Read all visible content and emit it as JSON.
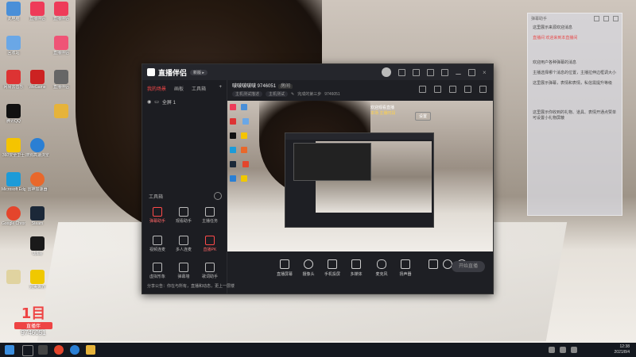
{
  "desktop_icons": [
    {
      "label": "此电脑",
      "color": "#4a8fd8"
    },
    {
      "label": "回收站",
      "color": "#6aa7e6"
    },
    {
      "label": "网易云音乐",
      "color": "#d33"
    },
    {
      "label": "腾讯QQ",
      "color": "#111"
    },
    {
      "label": "360安全卫士",
      "color": "#f5c400"
    },
    {
      "label": "Microsoft Edge",
      "color": "#1c9bd8"
    },
    {
      "label": "Google Chrome",
      "color": "#e4452c"
    },
    {
      "label": "",
      "color": "#e0d3a0"
    },
    {
      "label": "直播伴侣",
      "color": "#ee3b59"
    },
    {
      "label": "WeGame",
      "color": "#c22"
    },
    {
      "label": "搜狗高速浏览器",
      "color": "#2a7fd4"
    },
    {
      "label": "雷神加速器",
      "color": "#e8682b"
    },
    {
      "label": "Steam",
      "color": "#1b2838"
    },
    {
      "label": "Uplay",
      "color": "#1a1a1a"
    },
    {
      "label": "完美世界",
      "color": "#f0c800"
    },
    {
      "label": "直播伴侣",
      "color": "#ee3b59"
    },
    {
      "label": "直播伴侣",
      "color": "#ef5476"
    },
    {
      "label": "直播伴侣",
      "color": "#666"
    },
    {
      "label": "",
      "color": "#e6b33a"
    }
  ],
  "app": {
    "name": "直播伴侣",
    "version": "新版 ▸",
    "tabs": [
      "我的场景",
      "画板",
      "工具箱"
    ],
    "active_tab": "我的场景",
    "scene_label": "全屏 1",
    "tools_title": "工具箱",
    "tools": [
      {
        "label": "弹幕助手",
        "red": true
      },
      {
        "label": "观看助手",
        "red": false
      },
      {
        "label": "主播任务",
        "red": false
      },
      {
        "label": "视频连麦",
        "red": false
      },
      {
        "label": "多人连麦",
        "red": false
      },
      {
        "label": "直播PK",
        "red": true
      },
      {
        "label": "虚拟形象",
        "red": false
      },
      {
        "label": "弹幕墙",
        "red": false
      },
      {
        "label": "歌词助手",
        "red": false
      }
    ],
    "notice": "分享公告：你在与所有，直播和动态，更上一层楼",
    "room": {
      "name": "啵啵啵啵啵 9746051",
      "tag": "房间",
      "sub": [
        "主机测试描述",
        "主机测试",
        "完成的第三步"
      ],
      "id": "9746051"
    },
    "overlay": {
      "lines": [
        "欢迎观看直播",
        "本场 主播时段"
      ],
      "button": "设置"
    },
    "bottom_buttons": [
      "直播屏幕",
      "摄像头",
      "手机投屏",
      "多媒体",
      "麦克风",
      "扬声器"
    ],
    "start_button": "开始直播"
  },
  "chat": {
    "title": "弹幕助手",
    "lines": [
      "这里展示来源欢迎消息",
      "直播间 欢迎来到本直播间",
      "欢迎用户各种弹幕的消息",
      "主播选择哪个消息的位置，主播拉伸边框调大小",
      "这里展示弹幕，表情和表情，私信需提升等级",
      "这里展示你收到的礼物、道具、表情开通点赞单可设置小礼物屏蔽"
    ]
  },
  "taskbar": {
    "time": "12:38",
    "date": "2021/8/4"
  },
  "watermark": {
    "mark": "1目",
    "name": "直播伴",
    "id": "9746051"
  }
}
